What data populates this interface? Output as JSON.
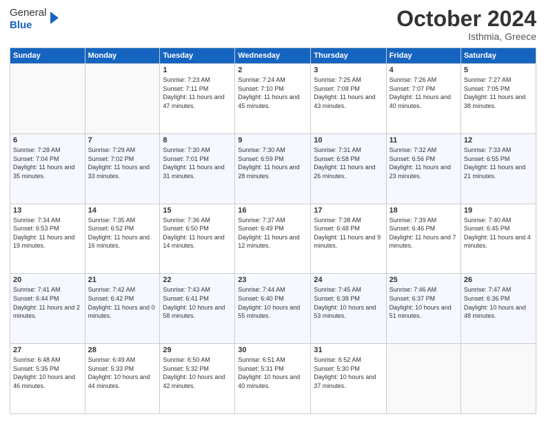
{
  "header": {
    "logo": {
      "line1": "General",
      "line2": "Blue"
    },
    "title": "October 2024",
    "location": "Isthmia, Greece"
  },
  "days_of_week": [
    "Sunday",
    "Monday",
    "Tuesday",
    "Wednesday",
    "Thursday",
    "Friday",
    "Saturday"
  ],
  "weeks": [
    [
      {
        "day": "",
        "sunrise": "",
        "sunset": "",
        "daylight": ""
      },
      {
        "day": "",
        "sunrise": "",
        "sunset": "",
        "daylight": ""
      },
      {
        "day": "1",
        "sunrise": "Sunrise: 7:23 AM",
        "sunset": "Sunset: 7:11 PM",
        "daylight": "Daylight: 11 hours and 47 minutes."
      },
      {
        "day": "2",
        "sunrise": "Sunrise: 7:24 AM",
        "sunset": "Sunset: 7:10 PM",
        "daylight": "Daylight: 11 hours and 45 minutes."
      },
      {
        "day": "3",
        "sunrise": "Sunrise: 7:25 AM",
        "sunset": "Sunset: 7:08 PM",
        "daylight": "Daylight: 11 hours and 43 minutes."
      },
      {
        "day": "4",
        "sunrise": "Sunrise: 7:26 AM",
        "sunset": "Sunset: 7:07 PM",
        "daylight": "Daylight: 11 hours and 40 minutes."
      },
      {
        "day": "5",
        "sunrise": "Sunrise: 7:27 AM",
        "sunset": "Sunset: 7:05 PM",
        "daylight": "Daylight: 11 hours and 38 minutes."
      }
    ],
    [
      {
        "day": "6",
        "sunrise": "Sunrise: 7:28 AM",
        "sunset": "Sunset: 7:04 PM",
        "daylight": "Daylight: 11 hours and 35 minutes."
      },
      {
        "day": "7",
        "sunrise": "Sunrise: 7:29 AM",
        "sunset": "Sunset: 7:02 PM",
        "daylight": "Daylight: 11 hours and 33 minutes."
      },
      {
        "day": "8",
        "sunrise": "Sunrise: 7:30 AM",
        "sunset": "Sunset: 7:01 PM",
        "daylight": "Daylight: 11 hours and 31 minutes."
      },
      {
        "day": "9",
        "sunrise": "Sunrise: 7:30 AM",
        "sunset": "Sunset: 6:59 PM",
        "daylight": "Daylight: 11 hours and 28 minutes."
      },
      {
        "day": "10",
        "sunrise": "Sunrise: 7:31 AM",
        "sunset": "Sunset: 6:58 PM",
        "daylight": "Daylight: 11 hours and 26 minutes."
      },
      {
        "day": "11",
        "sunrise": "Sunrise: 7:32 AM",
        "sunset": "Sunset: 6:56 PM",
        "daylight": "Daylight: 11 hours and 23 minutes."
      },
      {
        "day": "12",
        "sunrise": "Sunrise: 7:33 AM",
        "sunset": "Sunset: 6:55 PM",
        "daylight": "Daylight: 11 hours and 21 minutes."
      }
    ],
    [
      {
        "day": "13",
        "sunrise": "Sunrise: 7:34 AM",
        "sunset": "Sunset: 6:53 PM",
        "daylight": "Daylight: 11 hours and 19 minutes."
      },
      {
        "day": "14",
        "sunrise": "Sunrise: 7:35 AM",
        "sunset": "Sunset: 6:52 PM",
        "daylight": "Daylight: 11 hours and 16 minutes."
      },
      {
        "day": "15",
        "sunrise": "Sunrise: 7:36 AM",
        "sunset": "Sunset: 6:50 PM",
        "daylight": "Daylight: 11 hours and 14 minutes."
      },
      {
        "day": "16",
        "sunrise": "Sunrise: 7:37 AM",
        "sunset": "Sunset: 6:49 PM",
        "daylight": "Daylight: 11 hours and 12 minutes."
      },
      {
        "day": "17",
        "sunrise": "Sunrise: 7:38 AM",
        "sunset": "Sunset: 6:48 PM",
        "daylight": "Daylight: 11 hours and 9 minutes."
      },
      {
        "day": "18",
        "sunrise": "Sunrise: 7:39 AM",
        "sunset": "Sunset: 6:46 PM",
        "daylight": "Daylight: 11 hours and 7 minutes."
      },
      {
        "day": "19",
        "sunrise": "Sunrise: 7:40 AM",
        "sunset": "Sunset: 6:45 PM",
        "daylight": "Daylight: 11 hours and 4 minutes."
      }
    ],
    [
      {
        "day": "20",
        "sunrise": "Sunrise: 7:41 AM",
        "sunset": "Sunset: 6:44 PM",
        "daylight": "Daylight: 11 hours and 2 minutes."
      },
      {
        "day": "21",
        "sunrise": "Sunrise: 7:42 AM",
        "sunset": "Sunset: 6:42 PM",
        "daylight": "Daylight: 11 hours and 0 minutes."
      },
      {
        "day": "22",
        "sunrise": "Sunrise: 7:43 AM",
        "sunset": "Sunset: 6:41 PM",
        "daylight": "Daylight: 10 hours and 58 minutes."
      },
      {
        "day": "23",
        "sunrise": "Sunrise: 7:44 AM",
        "sunset": "Sunset: 6:40 PM",
        "daylight": "Daylight: 10 hours and 55 minutes."
      },
      {
        "day": "24",
        "sunrise": "Sunrise: 7:45 AM",
        "sunset": "Sunset: 6:38 PM",
        "daylight": "Daylight: 10 hours and 53 minutes."
      },
      {
        "day": "25",
        "sunrise": "Sunrise: 7:46 AM",
        "sunset": "Sunset: 6:37 PM",
        "daylight": "Daylight: 10 hours and 51 minutes."
      },
      {
        "day": "26",
        "sunrise": "Sunrise: 7:47 AM",
        "sunset": "Sunset: 6:36 PM",
        "daylight": "Daylight: 10 hours and 48 minutes."
      }
    ],
    [
      {
        "day": "27",
        "sunrise": "Sunrise: 6:48 AM",
        "sunset": "Sunset: 5:35 PM",
        "daylight": "Daylight: 10 hours and 46 minutes."
      },
      {
        "day": "28",
        "sunrise": "Sunrise: 6:49 AM",
        "sunset": "Sunset: 5:33 PM",
        "daylight": "Daylight: 10 hours and 44 minutes."
      },
      {
        "day": "29",
        "sunrise": "Sunrise: 6:50 AM",
        "sunset": "Sunset: 5:32 PM",
        "daylight": "Daylight: 10 hours and 42 minutes."
      },
      {
        "day": "30",
        "sunrise": "Sunrise: 6:51 AM",
        "sunset": "Sunset: 5:31 PM",
        "daylight": "Daylight: 10 hours and 40 minutes."
      },
      {
        "day": "31",
        "sunrise": "Sunrise: 6:52 AM",
        "sunset": "Sunset: 5:30 PM",
        "daylight": "Daylight: 10 hours and 37 minutes."
      },
      {
        "day": "",
        "sunrise": "",
        "sunset": "",
        "daylight": ""
      },
      {
        "day": "",
        "sunrise": "",
        "sunset": "",
        "daylight": ""
      }
    ]
  ]
}
